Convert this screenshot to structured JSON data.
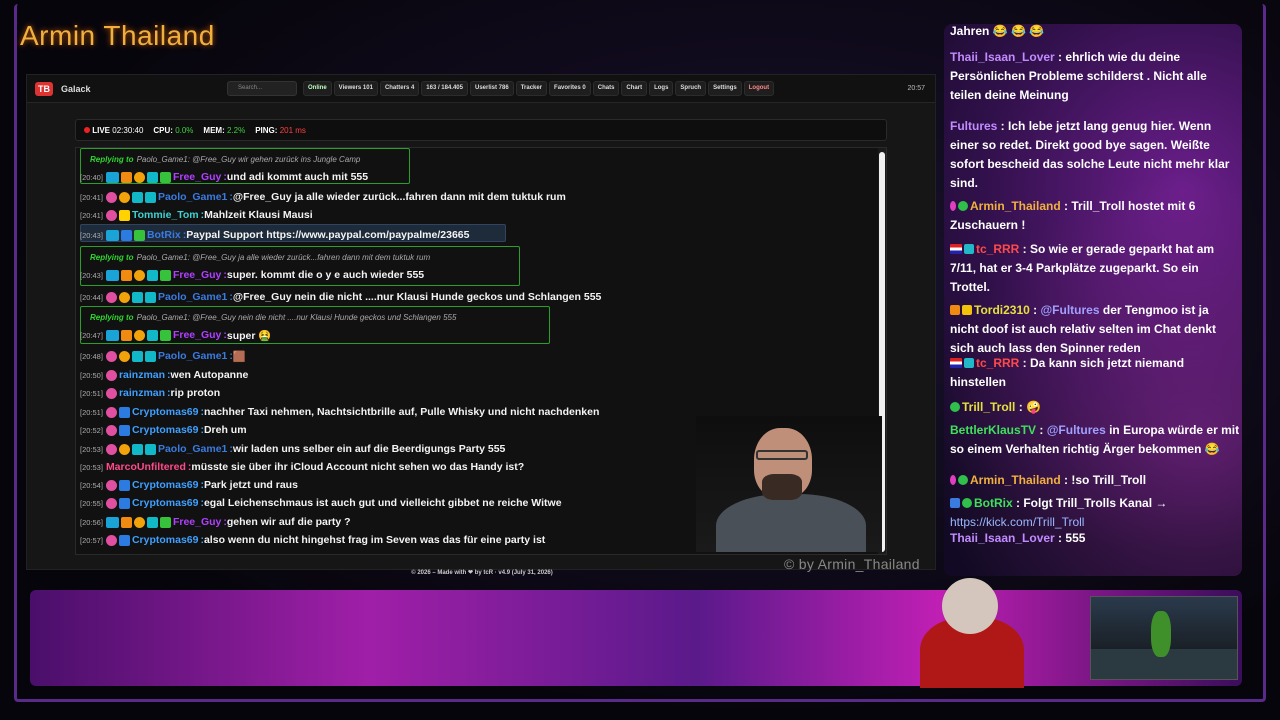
{
  "brand": "Armin Thailand",
  "app": {
    "logo": "TB",
    "name": "Galack",
    "search_placeholder": "Search...",
    "nav": [
      {
        "label": "Online",
        "icon": "online-icon"
      },
      {
        "label": "Viewers 101",
        "icon": "eye-icon"
      },
      {
        "label": "Chatters 4",
        "icon": "users-icon"
      },
      {
        "label": "163 / 184.405",
        "icon": "chat-icon"
      },
      {
        "label": "Userlist 786",
        "icon": "user-icon"
      },
      {
        "label": "Tracker",
        "icon": "tracker-icon"
      },
      {
        "label": "Favorites 0",
        "icon": "star-icon"
      },
      {
        "label": "Chats",
        "icon": "history-icon"
      },
      {
        "label": "Chart",
        "icon": "chart-icon"
      },
      {
        "label": "Logs",
        "icon": "logs-icon"
      },
      {
        "label": "Spruch",
        "icon": "quote-icon"
      },
      {
        "label": "Settings",
        "icon": "gear-icon"
      },
      {
        "label": "Logout",
        "icon": "logout-icon"
      }
    ],
    "clock": "20:57",
    "status": {
      "live_label": "LIVE",
      "live_value": "02:30:40",
      "cpu_label": "CPU:",
      "cpu_value": "0.0%",
      "mem_label": "MEM:",
      "mem_value": "2.2%",
      "ping_label": "PING:",
      "ping_value": "201 ms"
    },
    "footer": "© 2026 – Made with ❤ by tcR · v4.9 (July 31, 2026)"
  },
  "messages": [
    {
      "type": "reply",
      "prefix": "Replying to",
      "text": "Paolo_Game1: @Free_Guy wir gehen zurück ins Jungle Camp"
    },
    {
      "type": "msg",
      "time": "[20:40]",
      "user": "Free_Guy",
      "color": "#b040ff",
      "text": "und adi kommt auch mit 555"
    },
    {
      "type": "msg",
      "time": "[20:41]",
      "user": "Paolo_Game1",
      "color": "#3a7be0",
      "text": "@Free_Guy ja alle wieder zurück...fahren dann mit dem tuktuk rum"
    },
    {
      "type": "msg",
      "time": "[20:41]",
      "user": "Tommie_Tom",
      "color": "#3fd1d1",
      "text": "Mahlzeit Klausi Mausi"
    },
    {
      "type": "msg",
      "time": "[20:43]",
      "user": "BotRix",
      "color": "#3a7be0",
      "text": "Paypal Support https://www.paypal.com/paypalme/23665"
    },
    {
      "type": "reply",
      "prefix": "Replying to",
      "text": "Paolo_Game1: @Free_Guy ja alle wieder zurück...fahren dann mit dem tuktuk rum"
    },
    {
      "type": "msg",
      "time": "[20:43]",
      "user": "Free_Guy",
      "color": "#b040ff",
      "text": "super. kommt die o y e auch wieder 555"
    },
    {
      "type": "msg",
      "time": "[20:44]",
      "user": "Paolo_Game1",
      "color": "#3a7be0",
      "text": "@Free_Guy nein die nicht ....nur Klausi Hunde geckos und Schlangen 555"
    },
    {
      "type": "reply",
      "prefix": "Replying to",
      "text": "Paolo_Game1: @Free_Guy nein die nicht ....nur Klausi Hunde geckos und Schlangen 555"
    },
    {
      "type": "msg",
      "time": "[20:47]",
      "user": "Free_Guy",
      "color": "#b040ff",
      "text": "super 🤮"
    },
    {
      "type": "msg",
      "time": "[20:48]",
      "user": "Paolo_Game1",
      "color": "#3a7be0",
      "text": "🟫"
    },
    {
      "type": "msg",
      "time": "[20:50]",
      "user": "rainzman",
      "color": "#3fa0ff",
      "text": "wen Autopanne"
    },
    {
      "type": "msg",
      "time": "[20:51]",
      "user": "rainzman",
      "color": "#3fa0ff",
      "text": "rip proton"
    },
    {
      "type": "msg",
      "time": "[20:51]",
      "user": "Cryptomas69",
      "color": "#3fa0ff",
      "text": "nachher Taxi nehmen, Nachtsichtbrille auf, Pulle Whisky und nicht nachdenken"
    },
    {
      "type": "msg",
      "time": "[20:52]",
      "user": "Cryptomas69",
      "color": "#3fa0ff",
      "text": "Dreh um"
    },
    {
      "type": "msg",
      "time": "[20:53]",
      "user": "Paolo_Game1",
      "color": "#3a7be0",
      "text": "wir laden uns selber ein auf die Beerdigungs Party 555"
    },
    {
      "type": "msg",
      "time": "[20:53]",
      "user": "MarcoUnfiltered",
      "color": "#ff4a8a",
      "text": "müsste sie über ihr iCloud Account nicht sehen wo das Handy ist?"
    },
    {
      "type": "msg",
      "time": "[20:54]",
      "user": "Cryptomas69",
      "color": "#3fa0ff",
      "text": "Park jetzt und raus"
    },
    {
      "type": "msg",
      "time": "[20:55]",
      "user": "Cryptomas69",
      "color": "#3fa0ff",
      "text": "egal Leichenschmaus ist auch gut und vielleicht gibbet ne reiche Witwe"
    },
    {
      "type": "msg",
      "time": "[20:56]",
      "user": "Free_Guy",
      "color": "#b040ff",
      "text": "gehen wir auf die party ?"
    },
    {
      "type": "msg",
      "time": "[20:57]",
      "user": "Cryptomas69",
      "color": "#3fa0ff",
      "text": "also wenn du nicht hingehst frag im Seven was das für eine party ist"
    }
  ],
  "watermark": "© by Armin_Thailand",
  "side_chat": {
    "top_fragment": "Jahren 😂 😂 😂",
    "items": [
      {
        "user": "Thaii_Isaan_Lover",
        "text": "ehrlich wie du deine Persönlichen Probleme schilderst . Nicht alle teilen deine Meinung"
      },
      {
        "user": "Fultures",
        "text": "Ich lebe jetzt lang genug hier. Wenn einer so redet. Direkt good bye sagen. Weißte sofort bescheid das solche Leute nicht mehr klar sind."
      },
      {
        "user": "Armin_Thailand",
        "text": "Trill_Troll hostet mit 6 Zuschauern !"
      },
      {
        "user": "tc_RRR",
        "text": "So wie er gerade geparkt hat am 7/11, hat er 3-4 Parkplätze zugeparkt. So ein Trottel."
      },
      {
        "user": "Tordi2310",
        "mention": "@Fultures",
        "text": "der Tengmoo ist ja nicht doof ist auch relativ selten im Chat denkt sich auch lass den Spinner reden"
      },
      {
        "user": "tc_RRR",
        "text": "Da kann sich jetzt niemand hinstellen"
      },
      {
        "user": "Trill_Troll",
        "text": "🤪"
      },
      {
        "user": "BettlerKlausTV",
        "mention": "@Fultures",
        "text": "in Europa würde er mit so einem Verhalten richtig Ärger bekommen 😂"
      },
      {
        "user": "Armin_Thailand",
        "text": "!so Trill_Troll"
      },
      {
        "user": "BotRix",
        "text": "Folgt Trill_Trolls Kanal →",
        "link": "https://kick.com/Trill_Troll"
      },
      {
        "user": "Thaii_Isaan_Lover",
        "text": "555"
      }
    ]
  }
}
